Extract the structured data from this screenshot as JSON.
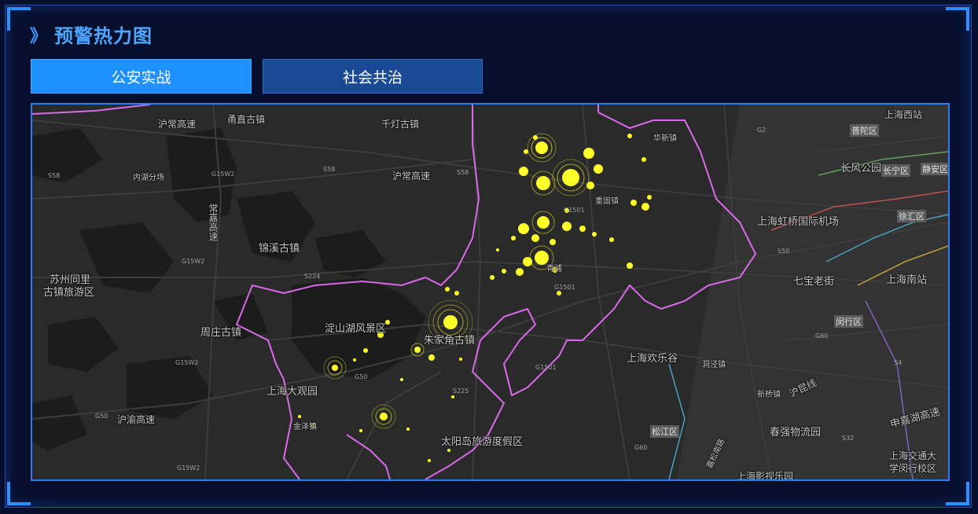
{
  "panel": {
    "title": "预警热力图"
  },
  "tabs": [
    {
      "label": "公安实战",
      "active": true
    },
    {
      "label": "社会共治",
      "active": false
    }
  ],
  "map": {
    "labels": {
      "hucheng_gaosu": "沪常高速",
      "yongzhi": "甬直古镇",
      "qiandeng": "千灯古镇",
      "huacao_fen": "内湖分场",
      "g15w2_a": "G15W2",
      "s58_a": "S58",
      "s58_b": "S58",
      "hucheng_gaosu_b": "沪常高速",
      "s58_c": "S58",
      "changjia": "常嘉高速",
      "jinxi": "锦溪古镇",
      "g15w2_b": "G15W2",
      "s224": "S224",
      "suzhou_tongli_1": "苏州同里",
      "suzhou_tongli_2": "古镇旅游区",
      "zhouzhuang": "周庄古镇",
      "dianshanhu": "淀山湖风景区",
      "zhujiajiao": "朱家角古镇",
      "g15w2_c": "G15W2",
      "g50_a": "G50",
      "shanghai_daguanyuan": "上海大观园",
      "g50_b": "G50",
      "huyu_gaosu": "沪渝高速",
      "jinze": "金泽镇",
      "s225": "S225",
      "taiyangdao": "太阳岛旅游度假区",
      "g15w2_d": "G15W2",
      "huaxin": "华新镇",
      "chonggu": "重固镇",
      "g1501_a": "G1501",
      "g1501_b": "G1501",
      "g1501_c": "G1501",
      "g2": "G2",
      "shanghai_xizhan": "上海西站",
      "changfeng": "长风公园",
      "hongqiao": "上海虹桥国际机场",
      "s50": "S50",
      "qibao": "七宝老街",
      "shanghai_nanzhan": "上海南站",
      "huanlegu": "上海欢乐谷",
      "dongjing": "洞泾镇",
      "g60": "G60",
      "xinqiao": "新桥镇",
      "hukunxian": "沪昆线",
      "chunqiang": "春强物流园",
      "g60_b": "G60",
      "s32": "S32",
      "s4": "S4",
      "shenjia": "申嘉湖高速",
      "jiaotong_1": "上海交通大",
      "jiaotong_2": "学闵行校区",
      "yingshi": "上海影视乐园",
      "songjiang_road": "嘉松南路"
    },
    "districts": {
      "putuo": "普陀区",
      "changning": "长宁区",
      "jingan": "静安区",
      "xuhui": "徐汇区",
      "minhang": "闵行区",
      "songjiang": "松江区",
      "qingpu_center": "青浦"
    },
    "colors": {
      "hotspot": "#ffff2a",
      "boundary": "#e070f0",
      "background": "#2a2a2a"
    }
  }
}
